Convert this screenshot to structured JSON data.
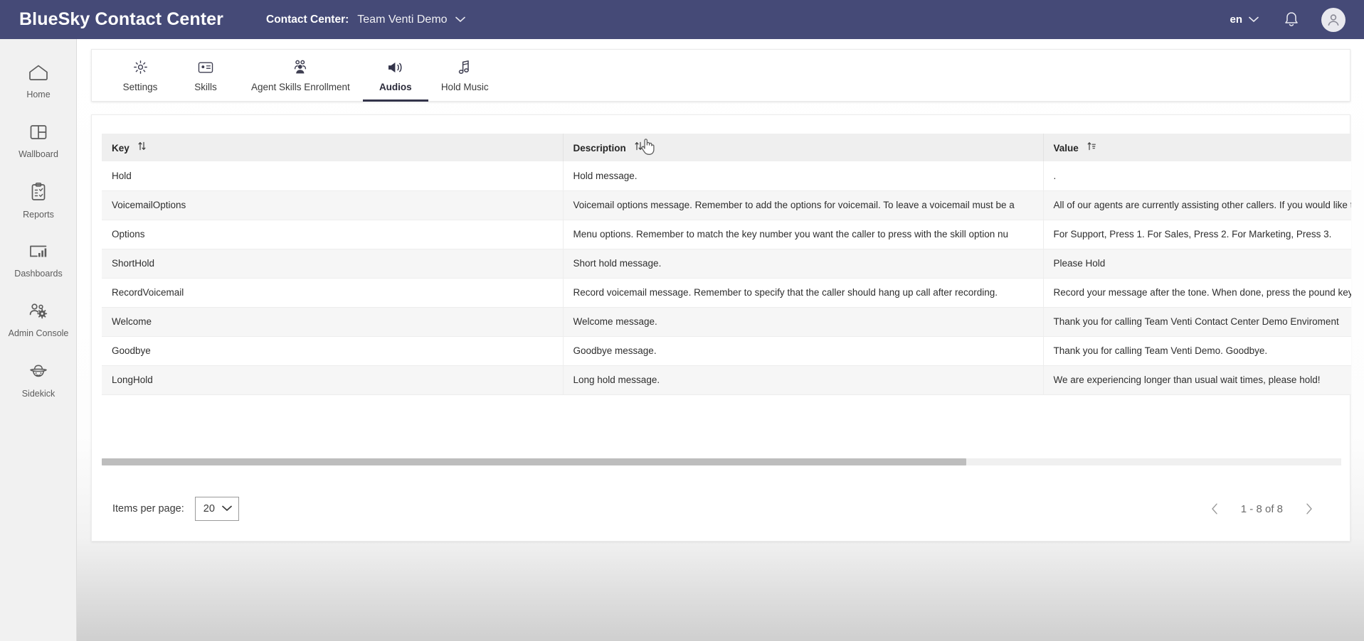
{
  "topbar": {
    "brand": "BlueSky Contact Center",
    "contact_center_label": "Contact Center:",
    "contact_center_value": "Team Venti Demo",
    "caret": "⌄",
    "language": "en",
    "lang_caret": "⌄",
    "bell_icon": "notification-bell-icon",
    "avatar_icon": "user-avatar-icon",
    "bg_color": "#454a77"
  },
  "sidebar": {
    "items": [
      {
        "label": "Home",
        "icon": "home-icon"
      },
      {
        "label": "Wallboard",
        "icon": "wallboard-grid-icon"
      },
      {
        "label": "Reports",
        "icon": "clipboard-report-icon"
      },
      {
        "label": "Dashboards",
        "icon": "dashboard-chart-icon"
      },
      {
        "label": "Admin Console",
        "icon": "people-gear-icon"
      },
      {
        "label": "Sidekick",
        "icon": "sidekick-hat-face-icon"
      }
    ]
  },
  "tabs": {
    "items": [
      {
        "label": "Settings",
        "icon": "gear-icon",
        "active": false
      },
      {
        "label": "Skills",
        "icon": "id-card-icon",
        "active": false
      },
      {
        "label": "Agent Skills Enrollment",
        "icon": "people-group-icon",
        "active": false
      },
      {
        "label": "Audios",
        "icon": "speaker-volume-icon",
        "active": true
      },
      {
        "label": "Hold Music",
        "icon": "music-note-icon",
        "active": false
      }
    ]
  },
  "table": {
    "columns": [
      {
        "label": "Key",
        "sort_icon": "sort-updown-icon"
      },
      {
        "label": "Description",
        "sort_icon": "sort-updown-icon"
      },
      {
        "label": "Value",
        "sort_icon": "sort-az-icon"
      }
    ],
    "rows": [
      {
        "key": "Hold",
        "description": "Hold message.",
        "value": "."
      },
      {
        "key": "VoicemailOptions",
        "description": "Voicemail options message. Remember to add the options for voicemail. To leave a voicemail must be a",
        "value": "All of our agents are currently assisting other callers. If you would like to bypa"
      },
      {
        "key": "Options",
        "description": "Menu options. Remember to match the key number you want the caller to press with the skill option nu",
        "value": "For Support, Press 1. For Sales, Press 2. For Marketing, Press 3."
      },
      {
        "key": "ShortHold",
        "description": "Short hold message.",
        "value": "Please Hold"
      },
      {
        "key": "RecordVoicemail",
        "description": "Record voicemail message. Remember to specify that the caller should hang up call after recording.",
        "value": "Record your message after the tone. When done, press the pound key."
      },
      {
        "key": "Welcome",
        "description": "Welcome message.",
        "value": "Thank you for calling Team Venti Contact Center Demo Enviroment"
      },
      {
        "key": "Goodbye",
        "description": "Goodbye message.",
        "value": "Thank you for calling Team Venti Demo. Goodbye."
      },
      {
        "key": "LongHold",
        "description": "Long hold message.",
        "value": "We are experiencing longer than usual wait times, please hold!"
      }
    ]
  },
  "paginator": {
    "items_per_page_label": "Items per page:",
    "items_per_page_value": "20",
    "caret": "⌄",
    "range_text": "1 - 8 of 8",
    "prev_icon": "chevron-left-icon",
    "next_icon": "chevron-right-icon"
  },
  "cursor": {
    "icon": "pointing-hand-cursor"
  }
}
